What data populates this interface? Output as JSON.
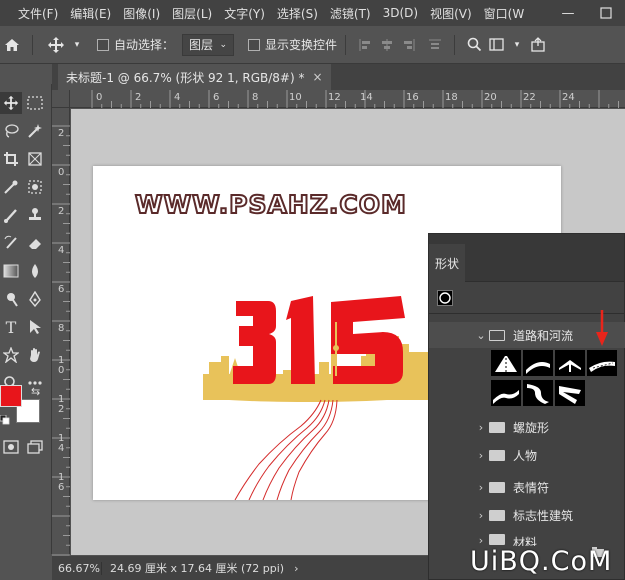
{
  "menu": {
    "items": [
      "文件(F)",
      "编辑(E)",
      "图像(I)",
      "图层(L)",
      "文字(Y)",
      "选择(S)",
      "滤镜(T)",
      "3D(D)",
      "视图(V)",
      "窗口(W"
    ],
    "window_controls": [
      "minimize-icon",
      "maximize-icon"
    ]
  },
  "options": {
    "auto_select_label": "自动选择：",
    "layer_select_value": "图层",
    "show_transform_label": "显示变换控件"
  },
  "document": {
    "tab_title": "未标题-1 @ 66.7% (形状 92 1, RGB/8#) *",
    "close_glyph": "×"
  },
  "rulers": {
    "top_labels": [
      "0",
      "2",
      "4",
      "6",
      "8",
      "10",
      "12",
      "14",
      "16",
      "18",
      "20",
      "22",
      "24"
    ],
    "left_labels": [
      "2",
      "0",
      "2",
      "4",
      "6",
      "8",
      "1\n0",
      "1\n2",
      "1\n4",
      "1\n6"
    ]
  },
  "canvas": {
    "watermark": "WWW.PSAHZ.COM",
    "artwork_number": "315",
    "artwork_colors": {
      "red": "#e8151b",
      "gold": "#e8c25a",
      "road": "#d42a2a"
    }
  },
  "status": {
    "zoom": "66.67%",
    "doc_size": "24.69 厘米 x 17.64 厘米 (72 ppi)",
    "arrow": "›"
  },
  "shapes_panel": {
    "tab_label": "形状",
    "open_group": "道路和河流",
    "groups": [
      "螺旋形",
      "人物",
      "表情符",
      "标志性建筑"
    ],
    "partial_group": "材料"
  },
  "colors": {
    "foreground": "#e8151b",
    "background": "#ffffff",
    "marker_arrow": "#e8251b"
  },
  "brand": "UiBQ.CoM"
}
